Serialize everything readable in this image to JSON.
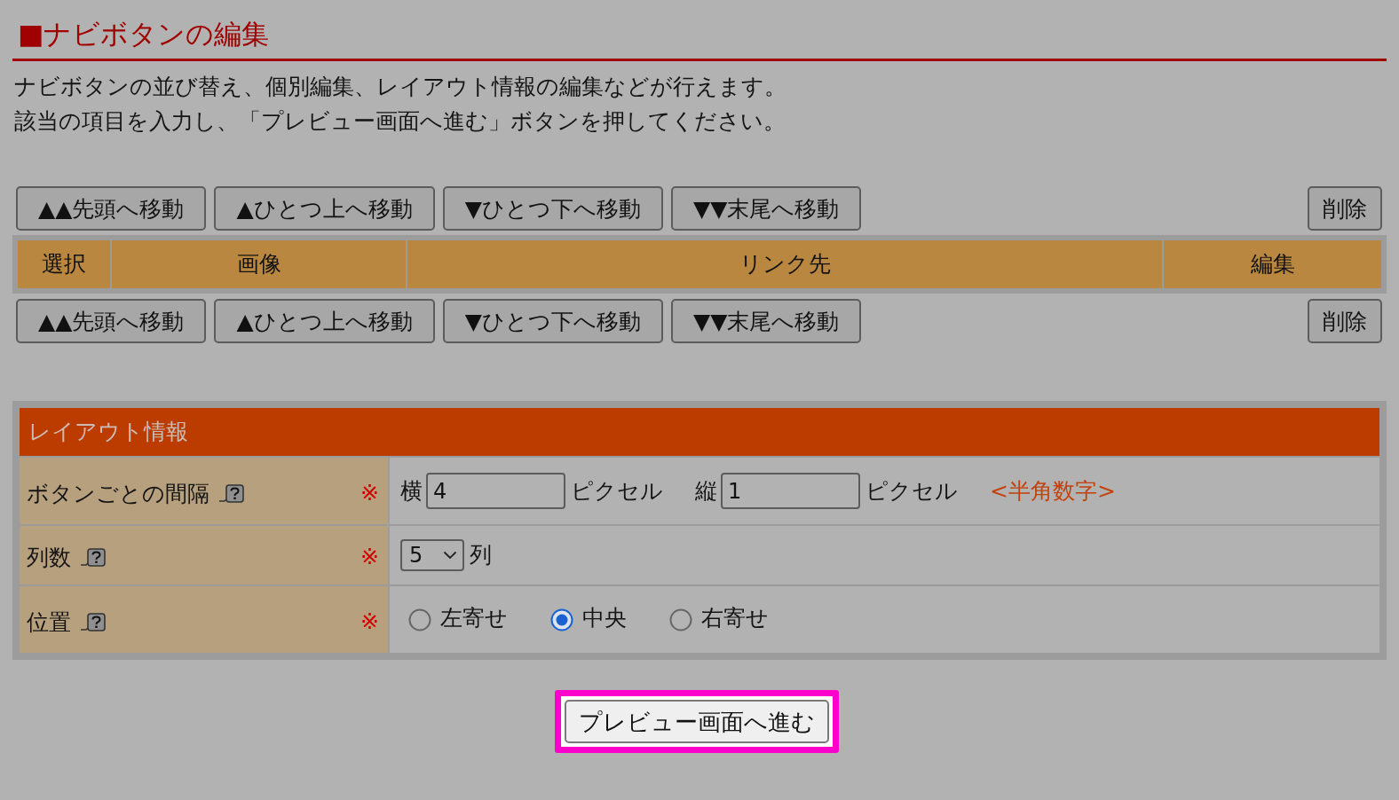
{
  "heading": {
    "title": "■ナビボタンの編集"
  },
  "description": [
    "ナビボタンの並び替え、個別編集、レイアウト情報の編集などが行えます。",
    "該当の項目を入力し、「プレビュー画面へ進む」ボタンを押してください。"
  ],
  "toolbars": [
    {
      "buttons": [
        {
          "label": "▲▲先頭へ移動",
          "kind": "move"
        },
        {
          "label": "▲ひとつ上へ移動",
          "kind": "move"
        },
        {
          "label": "▼ひとつ下へ移動",
          "kind": "move"
        },
        {
          "label": "▼▼末尾へ移動",
          "kind": "move"
        },
        {
          "label": "削除",
          "kind": "delete"
        }
      ]
    },
    {
      "buttons": [
        {
          "label": "▲▲先頭へ移動",
          "kind": "move"
        },
        {
          "label": "▲ひとつ上へ移動",
          "kind": "move"
        },
        {
          "label": "▼ひとつ下へ移動",
          "kind": "move"
        },
        {
          "label": "▼▼末尾へ移動",
          "kind": "move"
        },
        {
          "label": "削除",
          "kind": "delete"
        }
      ]
    }
  ],
  "table": {
    "columns": [
      "選択",
      "画像",
      "リンク先",
      "編集"
    ]
  },
  "layout_panel": {
    "title": "レイアウト情報",
    "rows": [
      {
        "kind": "spacing",
        "label": "ボタンごとの間隔",
        "required": "※",
        "inputs": [
          {
            "prefix": "横",
            "value": "4",
            "unit": "ピクセル"
          },
          {
            "prefix": "縦",
            "value": "1",
            "unit": "ピクセル"
          }
        ],
        "hint": "<半角数字>"
      },
      {
        "kind": "select",
        "label": "列数",
        "required": "※",
        "select": {
          "value": "5"
        },
        "unit": "列"
      },
      {
        "kind": "radio",
        "label": "位置",
        "required": "※",
        "options": [
          {
            "label": "左寄せ",
            "selected": false
          },
          {
            "label": "中央",
            "selected": true
          },
          {
            "label": "右寄せ",
            "selected": false
          }
        ]
      }
    ]
  },
  "submit": {
    "label": "プレビュー画面へ進む",
    "highlighted": true
  }
}
